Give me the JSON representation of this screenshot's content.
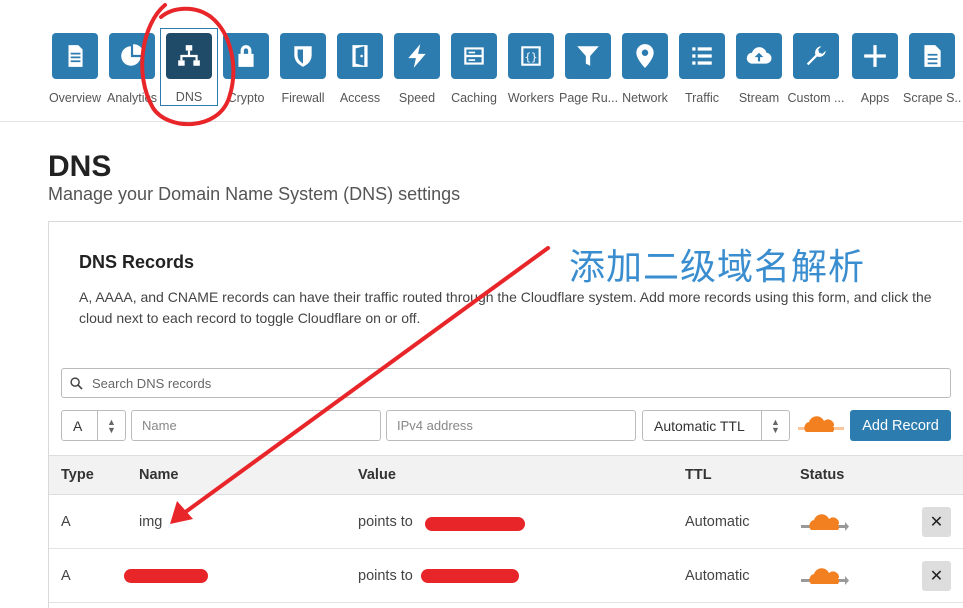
{
  "nav": {
    "items": [
      {
        "label": "Overview",
        "icon": "document-icon"
      },
      {
        "label": "Analytics",
        "icon": "pie-chart-icon"
      },
      {
        "label": "DNS",
        "icon": "network-tree-icon",
        "active": true
      },
      {
        "label": "Crypto",
        "icon": "lock-icon"
      },
      {
        "label": "Firewall",
        "icon": "shield-icon"
      },
      {
        "label": "Access",
        "icon": "door-icon"
      },
      {
        "label": "Speed",
        "icon": "lightning-icon"
      },
      {
        "label": "Caching",
        "icon": "server-icon"
      },
      {
        "label": "Workers",
        "icon": "braces-icon"
      },
      {
        "label": "Page Ru...",
        "icon": "filter-icon"
      },
      {
        "label": "Network",
        "icon": "location-pin-icon"
      },
      {
        "label": "Traffic",
        "icon": "list-icon"
      },
      {
        "label": "Stream",
        "icon": "cloud-upload-icon"
      },
      {
        "label": "Custom ...",
        "icon": "wrench-icon"
      },
      {
        "label": "Apps",
        "icon": "plus-icon"
      },
      {
        "label": "Scrape S...",
        "icon": "file-icon"
      }
    ]
  },
  "page": {
    "title": "DNS",
    "subtitle": "Manage your Domain Name System (DNS) settings"
  },
  "records_card": {
    "title": "DNS Records",
    "description": "A, AAAA, and CNAME records can have their traffic routed through the Cloudflare system. Add more records using this form, and click the cloud next to each record to toggle Cloudflare on or off.",
    "annotation": "添加二级域名解析"
  },
  "search": {
    "placeholder": "Search DNS records"
  },
  "form": {
    "type_value": "A",
    "name_placeholder": "Name",
    "value_placeholder": "IPv4 address",
    "ttl_value": "Automatic TTL",
    "add_label": "Add Record"
  },
  "table": {
    "headers": {
      "type": "Type",
      "name": "Name",
      "value": "Value",
      "ttl": "TTL",
      "status": "Status"
    },
    "rows": [
      {
        "type": "A",
        "name": "img",
        "value": "points to",
        "ttl": "Automatic",
        "delete": "✕"
      },
      {
        "type": "A",
        "name": "",
        "value": "points to",
        "ttl": "Automatic",
        "delete": "✕"
      }
    ]
  },
  "colors": {
    "accent": "#2c7cb0",
    "active_tile": "#1f4a68",
    "proxy_orange": "#f38020",
    "annotation": "#e8262a"
  }
}
